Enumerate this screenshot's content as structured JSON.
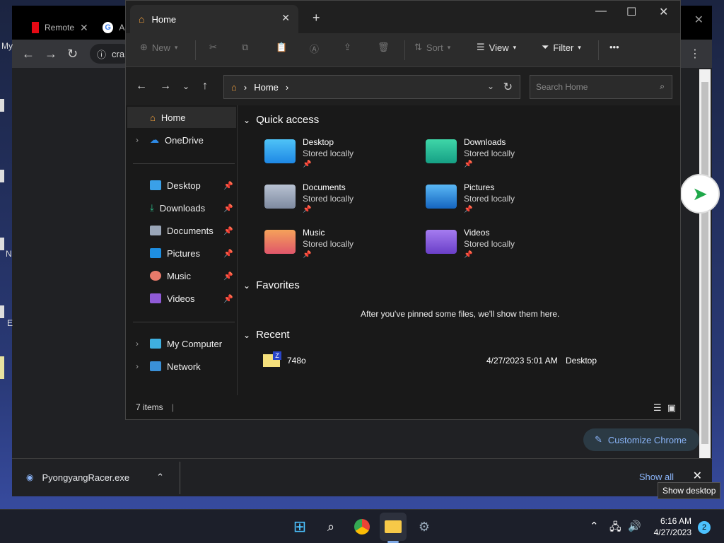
{
  "chrome": {
    "tab1_label": "Remote",
    "tab2_label": "AH",
    "omnibox_text": "cra",
    "left_labels": [
      "My",
      "N",
      "E"
    ],
    "customize_label": "Customize Chrome"
  },
  "downloads": {
    "file_name": "PyongyangRacer.exe",
    "show_all": "Show all"
  },
  "explorer": {
    "tab_title": "Home",
    "commands": {
      "new": "New",
      "sort": "Sort",
      "view": "View",
      "filter": "Filter",
      "more": "•••"
    },
    "address": {
      "crumb": "Home"
    },
    "search_placeholder": "Search Home",
    "sidebar": {
      "home": "Home",
      "onedrive": "OneDrive",
      "desktop": "Desktop",
      "downloads": "Downloads",
      "documents": "Documents",
      "pictures": "Pictures",
      "music": "Music",
      "videos": "Videos",
      "my_computer": "My Computer",
      "network": "Network"
    },
    "quick_access": {
      "title": "Quick access",
      "items": [
        {
          "name": "Desktop",
          "sub": "Stored locally"
        },
        {
          "name": "Downloads",
          "sub": "Stored locally"
        },
        {
          "name": "Documents",
          "sub": "Stored locally"
        },
        {
          "name": "Pictures",
          "sub": "Stored locally"
        },
        {
          "name": "Music",
          "sub": "Stored locally"
        },
        {
          "name": "Videos",
          "sub": "Stored locally"
        }
      ]
    },
    "favorites": {
      "title": "Favorites",
      "empty_text": "After you've pinned some files, we'll show them here."
    },
    "recent": {
      "title": "Recent",
      "items": [
        {
          "name": "748o",
          "date": "4/27/2023 5:01 AM",
          "location": "Desktop"
        }
      ]
    },
    "status": {
      "count": "7 items"
    }
  },
  "taskbar": {
    "time": "6:16 AM",
    "date": "4/27/2023",
    "notifications": "2",
    "tooltip": "Show desktop"
  },
  "colors": {
    "accent": "#4cc2ff",
    "link": "#8ab4f8"
  }
}
